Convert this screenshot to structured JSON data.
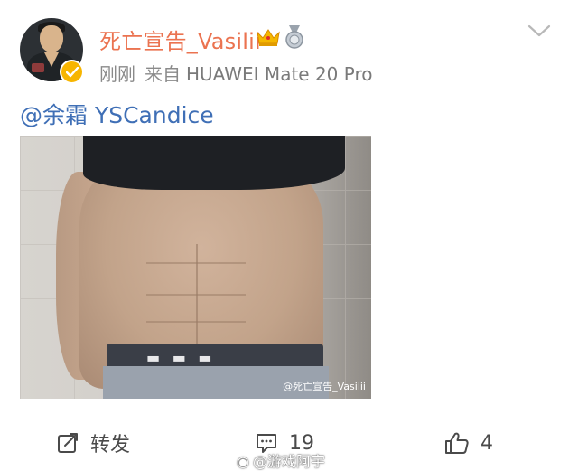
{
  "post": {
    "username": "死亡宣告_Vasilii",
    "time": "刚刚",
    "source_prefix": "来自",
    "device": "HUAWEI Mate 20 Pro",
    "mention": "@余霜 YSCandice",
    "image_watermark": "@死亡宣告_Vasilii"
  },
  "actions": {
    "repost_label": "转发",
    "comment_count": "19",
    "like_count": "4"
  },
  "footer_watermark": "@游戏阿宇",
  "colors": {
    "username": "#eb7350",
    "mention": "#3f6fb6",
    "verify_badge": "#f7b500",
    "meta_text": "#8a8a8a"
  },
  "icons": [
    "verified-icon",
    "crown-icon",
    "medal-icon",
    "chevron-down-icon",
    "repost-icon",
    "comment-icon",
    "like-icon"
  ]
}
